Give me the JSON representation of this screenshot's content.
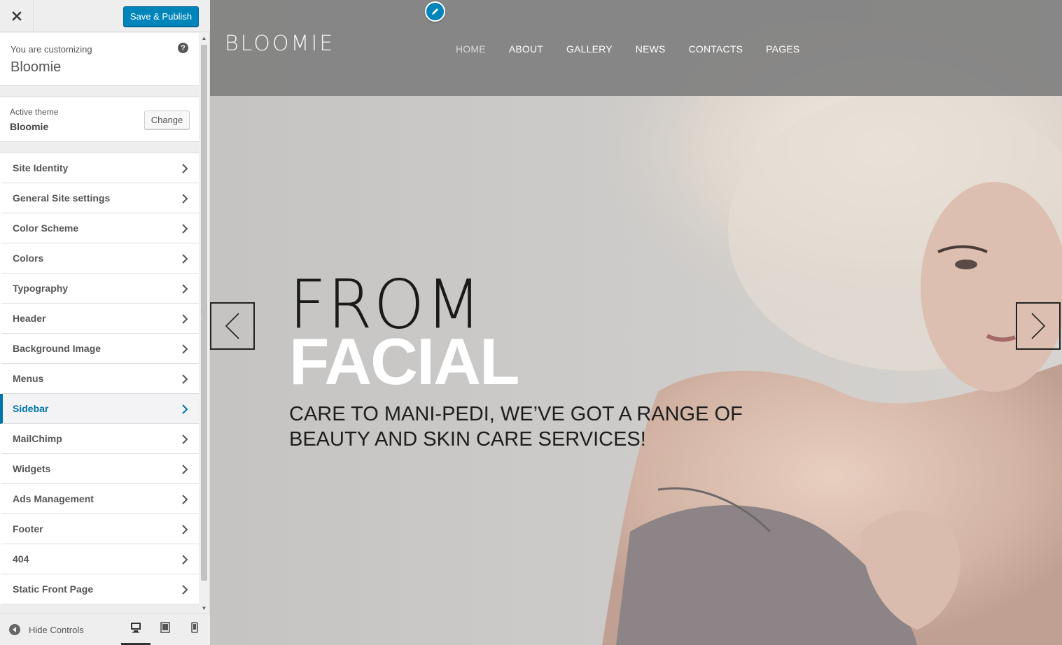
{
  "topbar": {
    "close_icon": "close-icon",
    "save_label": "Save & Publish"
  },
  "info": {
    "label": "You are customizing",
    "site_name": "Bloomie",
    "help_icon": "?"
  },
  "theme": {
    "label": "Active theme",
    "name": "Bloomie",
    "change_label": "Change"
  },
  "sections": [
    {
      "label": "Site Identity"
    },
    {
      "label": "General Site settings"
    },
    {
      "label": "Color Scheme"
    },
    {
      "label": "Colors"
    },
    {
      "label": "Typography"
    },
    {
      "label": "Header"
    },
    {
      "label": "Background Image"
    },
    {
      "label": "Menus"
    },
    {
      "label": "Sidebar"
    },
    {
      "label": "MailChimp"
    },
    {
      "label": "Widgets"
    },
    {
      "label": "Ads Management"
    },
    {
      "label": "Footer"
    },
    {
      "label": "404"
    },
    {
      "label": "Static Front Page"
    }
  ],
  "active_section": "Sidebar",
  "footer": {
    "hide_label": "Hide Controls",
    "devices": [
      "desktop",
      "tablet",
      "mobile"
    ],
    "active_device": "desktop"
  },
  "site": {
    "logo": "BLOOMIE",
    "nav": [
      "HOME",
      "ABOUT",
      "GALLERY",
      "NEWS",
      "CONTACTS",
      "PAGES"
    ],
    "current_nav": "HOME",
    "headline_1": "FROM",
    "headline_2": "FACIAL",
    "subline_1": "CARE TO MANI-PEDI, WE’VE GOT A RANGE OF",
    "subline_2": "BEAUTY AND SKIN CARE SERVICES!"
  },
  "colors": {
    "accent": "#0085ba",
    "active_section": "#0073aa",
    "panel_bg": "#eeeeee",
    "header_overlay": "#808080"
  }
}
